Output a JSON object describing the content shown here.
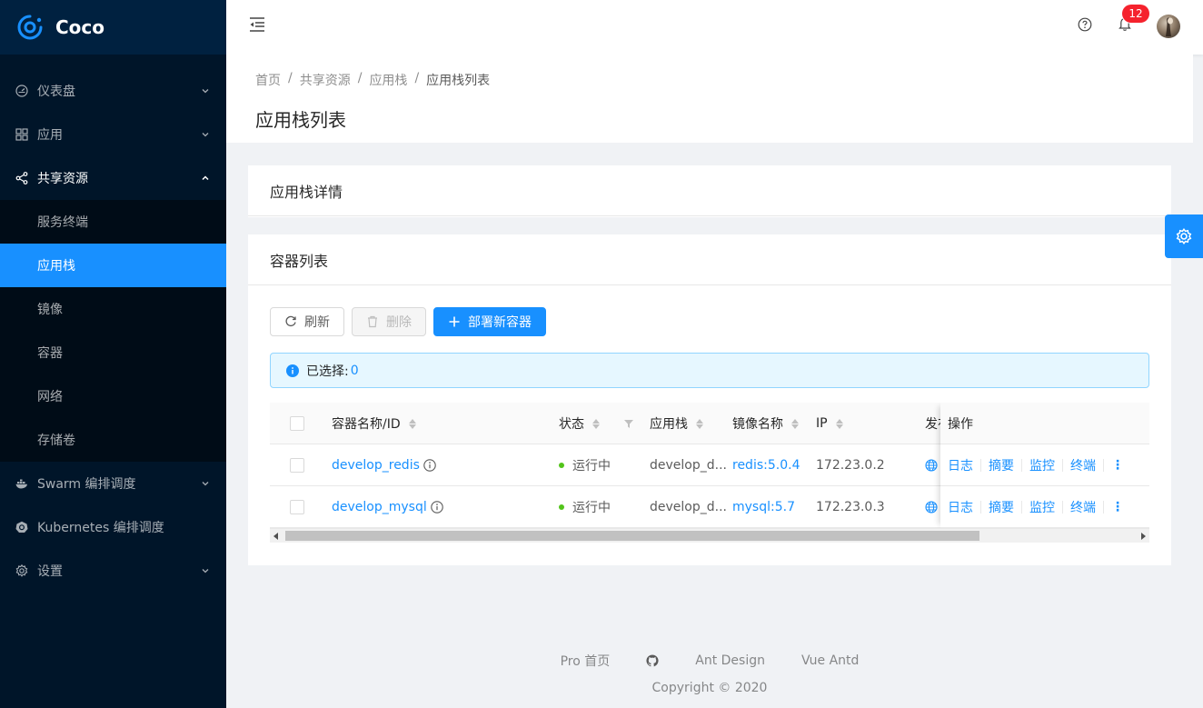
{
  "app": {
    "name": "Coco"
  },
  "sidebar": {
    "items": [
      {
        "label": "仪表盘",
        "icon": "dashboard-icon"
      },
      {
        "label": "应用",
        "icon": "appstore-icon"
      },
      {
        "label": "共享资源",
        "icon": "share-icon"
      },
      {
        "label": "Swarm 编排调度",
        "icon": "docker-icon"
      },
      {
        "label": "Kubernetes 编排调度",
        "icon": "kubernetes-icon"
      },
      {
        "label": "设置",
        "icon": "setting-icon"
      }
    ],
    "submenu": [
      {
        "label": "服务终端"
      },
      {
        "label": "应用栈"
      },
      {
        "label": "镜像"
      },
      {
        "label": "容器"
      },
      {
        "label": "网络"
      },
      {
        "label": "存储卷"
      }
    ]
  },
  "header": {
    "notification_count": "12"
  },
  "breadcrumb": [
    "首页",
    "共享资源",
    "应用栈",
    "应用栈列表"
  ],
  "page": {
    "title": "应用栈列表"
  },
  "cards": {
    "detail_title": "应用栈详情",
    "containers_title": "容器列表"
  },
  "toolbar": {
    "refresh_label": "刷新",
    "delete_label": "删除",
    "deploy_label": "部署新容器"
  },
  "alert": {
    "label": "已选择:",
    "count": "0"
  },
  "table": {
    "columns": [
      "容器名称/ID",
      "状态",
      "应用栈",
      "镜像名称",
      "IP",
      "发布",
      "操作"
    ],
    "rows": [
      {
        "name": "develop_redis",
        "status": "运行中",
        "stack": "develop_d...",
        "image": "redis:5.0.4",
        "ip": "172.23.0.2"
      },
      {
        "name": "develop_mysql",
        "status": "运行中",
        "stack": "develop_d...",
        "image": "mysql:5.7",
        "ip": "172.23.0.3"
      }
    ],
    "actions": [
      "日志",
      "摘要",
      "监控",
      "终端"
    ],
    "more": "⋮"
  },
  "footer": {
    "links": [
      "Pro 首页",
      "Ant Design",
      "Vue Antd"
    ],
    "copyright": "Copyright © 2020"
  },
  "colors": {
    "primary": "#1890ff",
    "sider": "#001529",
    "success": "#52c41a",
    "badge": "#f5222d"
  }
}
